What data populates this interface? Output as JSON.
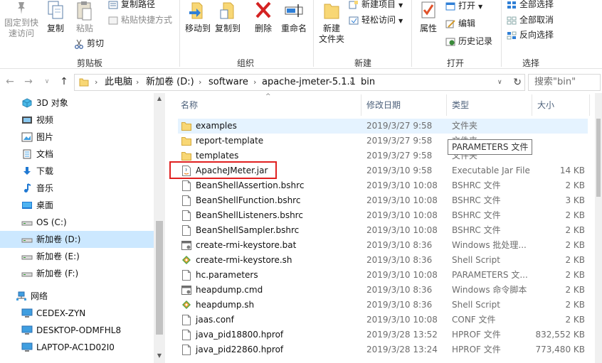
{
  "ribbon": {
    "clipboard": {
      "pin_label": "固定到快\n速访问",
      "copy_label": "复制",
      "paste_label": "粘贴",
      "copy_path_label": "复制路径",
      "paste_shortcut_label": "粘贴快捷方式",
      "cut_label": "剪切",
      "group_label": "剪贴板"
    },
    "organize": {
      "move_to_label": "移动到",
      "copy_to_label": "复制到",
      "delete_label": "删除",
      "rename_label": "重命名",
      "group_label": "组织"
    },
    "new": {
      "new_folder_label": "新建\n文件夹",
      "new_item_label": "新建项目",
      "easy_access_label": "轻松访问",
      "group_label": "新建"
    },
    "open": {
      "properties_label": "属性",
      "open_label": "打开",
      "edit_label": "编辑",
      "history_label": "历史记录",
      "group_label": "打开"
    },
    "select": {
      "select_all_label": "全部选择",
      "select_none_label": "全部取消",
      "invert_label": "反向选择",
      "group_label": "选择"
    }
  },
  "address": {
    "crumbs": [
      "此电脑",
      "新加卷 (D:)",
      "software",
      "apache-jmeter-5.1.1",
      "bin"
    ],
    "search_placeholder": "搜索\"bin\""
  },
  "nav": {
    "items": [
      {
        "label": "3D 对象",
        "icon": "3d-objects-icon"
      },
      {
        "label": "视频",
        "icon": "video-folder-icon"
      },
      {
        "label": "图片",
        "icon": "pictures-folder-icon"
      },
      {
        "label": "文档",
        "icon": "documents-folder-icon"
      },
      {
        "label": "下载",
        "icon": "downloads-folder-icon"
      },
      {
        "label": "音乐",
        "icon": "music-folder-icon"
      },
      {
        "label": "桌面",
        "icon": "desktop-folder-icon"
      },
      {
        "label": "OS (C:)",
        "icon": "drive-icon"
      },
      {
        "label": "新加卷 (D:)",
        "icon": "drive-icon",
        "selected": true
      },
      {
        "label": "新加卷 (E:)",
        "icon": "drive-icon"
      },
      {
        "label": "新加卷 (F:)",
        "icon": "drive-icon"
      },
      {
        "label": "网络",
        "icon": "network-icon"
      },
      {
        "label": "CEDEX-ZYN",
        "icon": "computer-icon"
      },
      {
        "label": "DESKTOP-ODMFHL8",
        "icon": "computer-icon"
      },
      {
        "label": "LAPTOP-AC1D02I0",
        "icon": "computer-icon"
      }
    ]
  },
  "columns": {
    "name": "名称",
    "date": "修改日期",
    "type": "类型",
    "size": "大小"
  },
  "files": [
    {
      "name": "examples",
      "date": "2019/3/27 9:58",
      "type": "文件夹",
      "size": "",
      "icon": "folder-icon",
      "highlighted": true
    },
    {
      "name": "report-template",
      "date": "2019/3/27 9:58",
      "type": "文件夹",
      "size": "",
      "icon": "folder-icon"
    },
    {
      "name": "templates",
      "date": "2019/3/27 9:58",
      "type": "文件夹",
      "size": "",
      "icon": "folder-icon"
    },
    {
      "name": "ApacheJMeter.jar",
      "date": "2019/3/10 9:58",
      "type": "Executable Jar File",
      "size": "14 KB",
      "icon": "jar-file-icon"
    },
    {
      "name": "BeanShellAssertion.bshrc",
      "date": "2019/3/10 10:08",
      "type": "BSHRC 文件",
      "size": "2 KB",
      "icon": "file-icon"
    },
    {
      "name": "BeanShellFunction.bshrc",
      "date": "2019/3/10 10:08",
      "type": "BSHRC 文件",
      "size": "3 KB",
      "icon": "file-icon"
    },
    {
      "name": "BeanShellListeners.bshrc",
      "date": "2019/3/10 10:08",
      "type": "BSHRC 文件",
      "size": "2 KB",
      "icon": "file-icon"
    },
    {
      "name": "BeanShellSampler.bshrc",
      "date": "2019/3/10 10:08",
      "type": "BSHRC 文件",
      "size": "2 KB",
      "icon": "file-icon"
    },
    {
      "name": "create-rmi-keystore.bat",
      "date": "2019/3/10 8:36",
      "type": "Windows 批处理...",
      "size": "2 KB",
      "icon": "batch-file-icon"
    },
    {
      "name": "create-rmi-keystore.sh",
      "date": "2019/3/10 8:36",
      "type": "Shell Script",
      "size": "2 KB",
      "icon": "shell-script-icon"
    },
    {
      "name": "hc.parameters",
      "date": "2019/3/10 10:08",
      "type": "PARAMETERS 文...",
      "size": "2 KB",
      "icon": "file-icon"
    },
    {
      "name": "heapdump.cmd",
      "date": "2019/3/10 8:36",
      "type": "Windows 命令脚本",
      "size": "2 KB",
      "icon": "batch-file-icon"
    },
    {
      "name": "heapdump.sh",
      "date": "2019/3/10 8:36",
      "type": "Shell Script",
      "size": "2 KB",
      "icon": "shell-script-icon"
    },
    {
      "name": "jaas.conf",
      "date": "2019/3/10 10:08",
      "type": "CONF 文件",
      "size": "2 KB",
      "icon": "file-icon"
    },
    {
      "name": "java_pid18800.hprof",
      "date": "2019/3/28 13:52",
      "type": "HPROF 文件",
      "size": "832,552 KB",
      "icon": "file-icon"
    },
    {
      "name": "java_pid22860.hprof",
      "date": "2019/3/28 13:24",
      "type": "HPROF 文件",
      "size": "773,480 KB",
      "icon": "file-icon"
    }
  ],
  "tooltip": "PARAMETERS 文件",
  "colors": {
    "selection": "#cce8ff",
    "hover": "#e5f3ff",
    "annotation_box": "#e02020",
    "folder": "#f8d775"
  }
}
